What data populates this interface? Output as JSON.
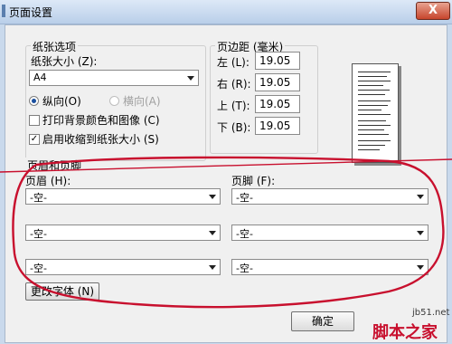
{
  "window": {
    "title": "页面设置",
    "close_label": "X"
  },
  "paper": {
    "group_label": "纸张选项",
    "size_label": "纸张大小 (Z):",
    "size_value": "A4",
    "portrait_label": "纵向(O)",
    "landscape_label": "横向(A)",
    "print_bg_label": "打印背景颜色和图像 (C)",
    "print_bg_checked": false,
    "shrink_label": "启用收缩到纸张大小 (S)",
    "shrink_checked": true,
    "check_mark": "✓"
  },
  "margins": {
    "group_label": "页边距 (毫米)",
    "left_label": "左 (L):",
    "left_value": "19.05",
    "right_label": "右 (R):",
    "right_value": "19.05",
    "top_label": "上 (T):",
    "top_value": "19.05",
    "bottom_label": "下 (B):",
    "bottom_value": "19.05"
  },
  "header_footer": {
    "group_label": "页眉和页脚",
    "header_label": "页眉 (H):",
    "footer_label": "页脚 (F):",
    "header_values": [
      "-空-",
      "-空-",
      "-空-"
    ],
    "footer_values": [
      "-空-",
      "-空-",
      "-空-"
    ],
    "change_font_label": "更改字体 (N)"
  },
  "buttons": {
    "ok_label": "确定"
  },
  "watermark": {
    "url": "jb51.net",
    "site_name": "脚本之家"
  },
  "colors": {
    "annotation_red": "#c8102e",
    "window_frame": "#c9d9ec",
    "dialog_bg": "#f0f0f0"
  }
}
